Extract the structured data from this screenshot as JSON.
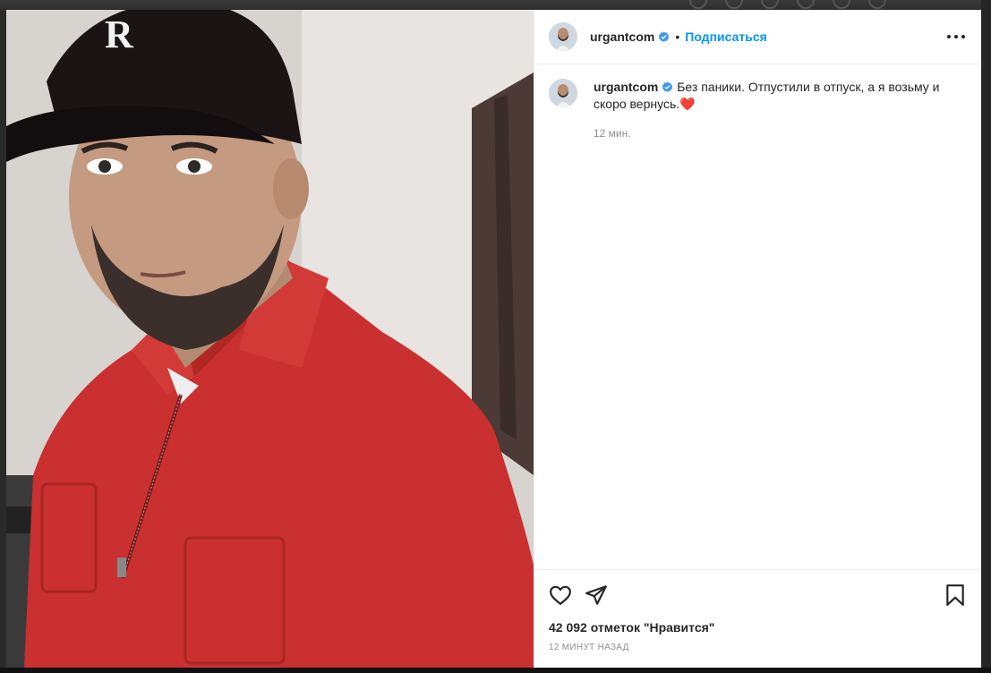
{
  "post": {
    "username": "urgantcom",
    "verified": true,
    "separator": "•",
    "follow_label": "Подписаться",
    "caption": "Без паники. Отпустили в отпуск, а я возьму и скоро вернусь.❤️",
    "caption_time": "12 мин.",
    "likes_text": "42 092 отметок \"Нравится\"",
    "posted_time": "12 МИНУТ НАЗАД",
    "photo_cap_letter": "R"
  },
  "icons": {
    "more": "more-options-icon",
    "like": "heart-icon",
    "share": "share-icon",
    "save": "bookmark-icon",
    "verified": "verified-badge-icon"
  },
  "colors": {
    "accent": "#0095f6",
    "verified": "#3897f0",
    "text": "#262626",
    "muted": "#8e8e8e",
    "jacket": "#c9302f"
  }
}
